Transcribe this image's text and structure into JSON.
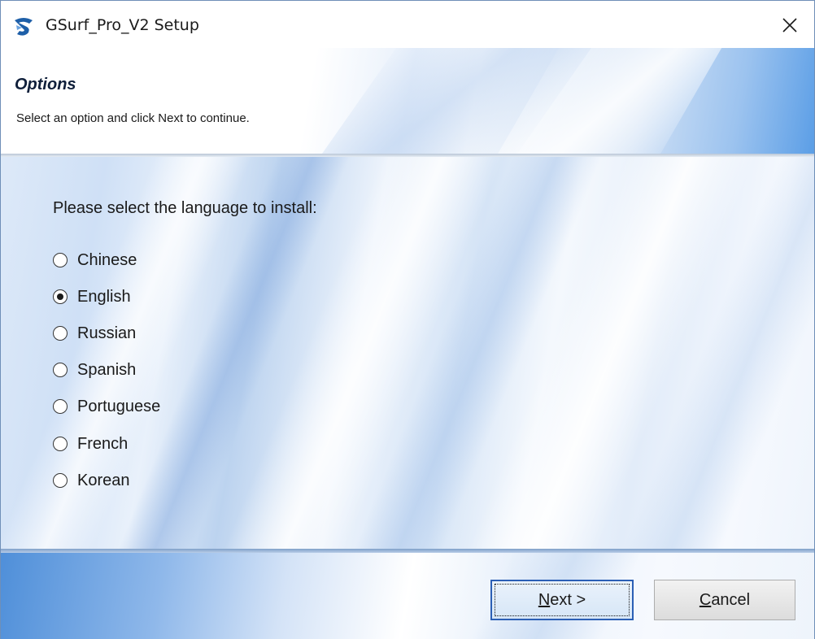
{
  "window": {
    "title": "GSurf_Pro_V2 Setup"
  },
  "header": {
    "title": "Options",
    "subtitle": "Select an option and click Next to continue."
  },
  "content": {
    "prompt": "Please select the language to install:",
    "selected": "English",
    "options": [
      {
        "label": "Chinese",
        "checked": false
      },
      {
        "label": "English",
        "checked": true
      },
      {
        "label": "Russian",
        "checked": false
      },
      {
        "label": "Spanish",
        "checked": false
      },
      {
        "label": "Portuguese",
        "checked": false
      },
      {
        "label": "French",
        "checked": false
      },
      {
        "label": "Korean",
        "checked": false
      }
    ]
  },
  "buttons": {
    "next_mnemonic": "N",
    "next_rest": "ext >",
    "cancel_mnemonic": "C",
    "cancel_rest": "ancel"
  },
  "icons": {
    "app": "gsurf-app-icon",
    "close": "close-icon"
  },
  "colors": {
    "accent_blue": "#2b5fb5",
    "banner_blue": "#5b9ee6"
  }
}
